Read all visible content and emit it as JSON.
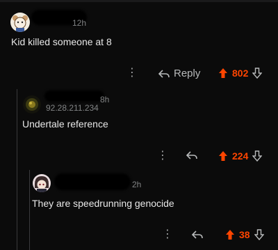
{
  "comments": [
    {
      "timestamp": "12h",
      "body": "Kid killed someone at 8",
      "reply_label": "Reply",
      "votes": "802"
    },
    {
      "timestamp": "8h",
      "ip": "92.28.211.234",
      "body": "Undertale reference",
      "votes": "224"
    },
    {
      "timestamp": "2h",
      "body": "They are speedrunning genocide",
      "votes": "38"
    }
  ],
  "colors": {
    "background": "#0b0b0b",
    "upvote_active": "#ff4500",
    "thread_line": "#3a3a3c",
    "muted_text": "#818384"
  },
  "icons": {
    "more": "more-options-icon",
    "reply": "reply-arrow-icon",
    "upvote": "upvote-arrow-icon",
    "downvote": "downvote-arrow-icon"
  }
}
